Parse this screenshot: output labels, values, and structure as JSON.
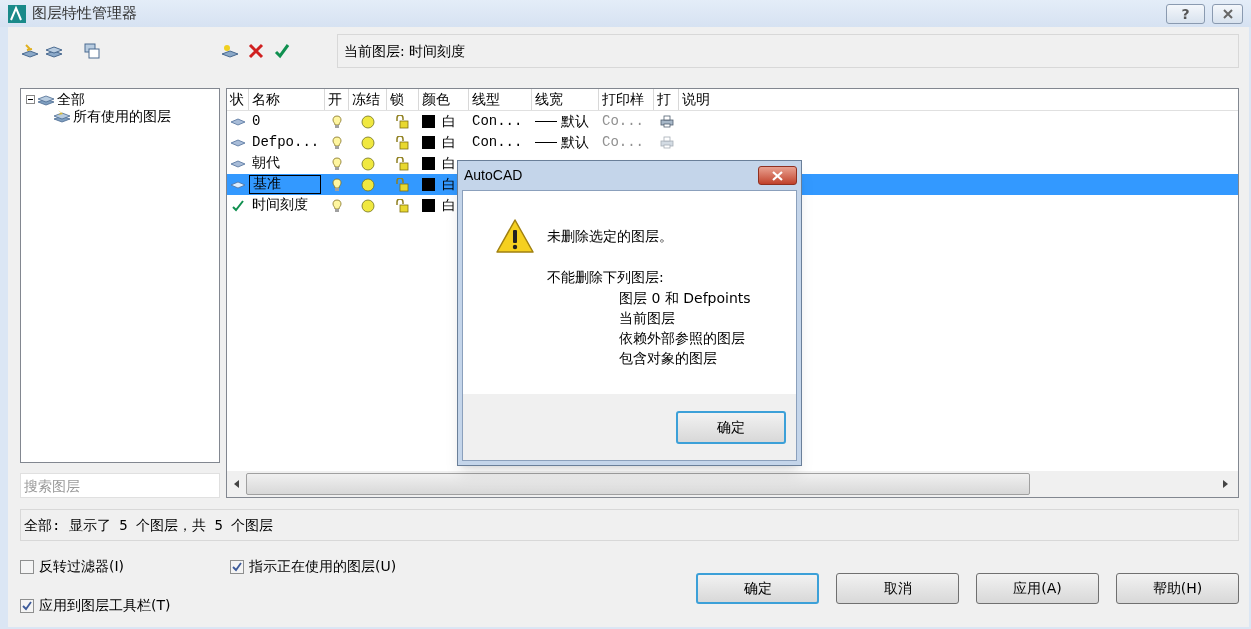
{
  "window": {
    "title": "图层特性管理器",
    "buttons": [
      {
        "kind": "help",
        "label": "?"
      },
      {
        "kind": "close"
      }
    ]
  },
  "current_layer": "当前图层: 时间刻度",
  "tree": {
    "label": "全部",
    "expanded": true,
    "children": [
      {
        "label": "所有使用的图层"
      }
    ]
  },
  "search": {
    "placeholder": "搜索图层"
  },
  "table": {
    "columns": [
      "状",
      "名称",
      "开",
      "冻结",
      "锁",
      "颜色",
      "线型",
      "线宽",
      "打印样",
      "打",
      "说明"
    ],
    "rows": [
      {
        "current": false,
        "name": "0",
        "selected": false,
        "editing": false,
        "on": true,
        "frozen": false,
        "locked": false,
        "color": "#000000",
        "color_name": "白",
        "linetype": "Con...",
        "lineweight": "默认",
        "plot_style": "Co...",
        "plot": true
      },
      {
        "current": false,
        "name": "Defpo...",
        "selected": false,
        "editing": false,
        "on": true,
        "frozen": false,
        "locked": false,
        "color": "#000000",
        "color_name": "白",
        "linetype": "Con...",
        "lineweight": "默认",
        "plot_style": "Co...",
        "plot": false
      },
      {
        "current": false,
        "name": "朝代",
        "selected": false,
        "editing": false,
        "on": true,
        "frozen": false,
        "locked": false,
        "color": "#000000",
        "color_name": "白"
      },
      {
        "current": false,
        "name": "基准",
        "selected": true,
        "editing": true,
        "on": true,
        "frozen": false,
        "locked": false,
        "color": "#000000",
        "color_name": "白"
      },
      {
        "current": true,
        "name": "时间刻度",
        "selected": false,
        "editing": false,
        "on": true,
        "frozen": false,
        "locked": false,
        "color": "#000000",
        "color_name": "白"
      }
    ]
  },
  "status_bar": "全部: 显示了 5 个图层，共 5 个图层",
  "options": [
    {
      "label": "反转过滤器(I)",
      "checked": false
    },
    {
      "label": "指示正在使用的图层(U)",
      "checked": true
    },
    {
      "label": "应用到图层工具栏(T)",
      "checked": true
    }
  ],
  "buttons": [
    {
      "label": "确定",
      "default": true
    },
    {
      "label": "取消",
      "default": false
    },
    {
      "label": "应用(A)",
      "default": false
    },
    {
      "label": "帮助(H)",
      "default": false
    }
  ],
  "dialog": {
    "title": "AutoCAD",
    "message": "未删除选定的图层。",
    "intro": "不能删除下列图层:",
    "reasons": [
      "图层 0 和 Defpoints",
      "当前图层",
      "依赖外部参照的图层",
      "包含对象的图层"
    ],
    "button": "确定"
  }
}
